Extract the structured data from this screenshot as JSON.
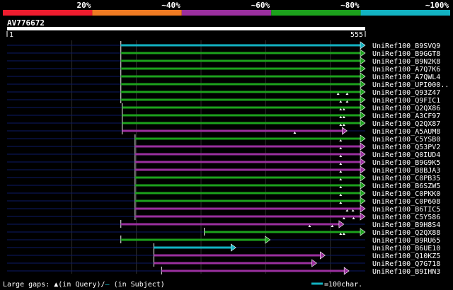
{
  "identity_scale": {
    "segments": [
      {
        "label": "20%",
        "color": "#ee1c2e"
      },
      {
        "label": "~40%",
        "color": "#ee7a22"
      },
      {
        "label": "~60%",
        "color": "#9a2f9e"
      },
      {
        "label": "~80%",
        "color": "#1ca11c"
      },
      {
        "label": "~100%",
        "color": "#12b2c2"
      }
    ]
  },
  "query": {
    "id": "AV776672",
    "start_label": "1",
    "end_label": "555",
    "length": 555
  },
  "hits": [
    {
      "name": "UniRef100_B9SVQ9",
      "start": 177,
      "end": 555,
      "color": "#12b2c2",
      "gaps": []
    },
    {
      "name": "UniRef100_B9GGT8",
      "start": 177,
      "end": 555,
      "color": "#1ca11c",
      "gaps": []
    },
    {
      "name": "UniRef100_B9N2K8",
      "start": 177,
      "end": 555,
      "color": "#1ca11c",
      "gaps": []
    },
    {
      "name": "UniRef100_A7Q7K6",
      "start": 177,
      "end": 555,
      "color": "#1ca11c",
      "gaps": []
    },
    {
      "name": "UniRef100_A7QWL4",
      "start": 177,
      "end": 555,
      "color": "#1ca11c",
      "gaps": []
    },
    {
      "name": "UniRef100_UPI000..",
      "start": 177,
      "end": 555,
      "color": "#1ca11c",
      "gaps": []
    },
    {
      "name": "UniRef100_Q93Z47",
      "start": 177,
      "end": 555,
      "color": "#1ca11c",
      "gaps": [
        513,
        527
      ]
    },
    {
      "name": "UniRef100_Q9FIC1",
      "start": 177,
      "end": 555,
      "color": "#1ca11c",
      "gaps": [
        517,
        527
      ]
    },
    {
      "name": "UniRef100_Q2QX86",
      "start": 179,
      "end": 555,
      "color": "#1ca11c",
      "gaps": [
        517,
        522
      ]
    },
    {
      "name": "UniRef100_A3CF97",
      "start": 179,
      "end": 555,
      "color": "#1ca11c",
      "gaps": [
        517,
        522
      ]
    },
    {
      "name": "UniRef100_Q2QX87",
      "start": 179,
      "end": 555,
      "color": "#1ca11c",
      "gaps": [
        517,
        522
      ]
    },
    {
      "name": "UniRef100_A5AUM8",
      "start": 179,
      "end": 527,
      "color": "#9a2f9e",
      "gaps": [
        446
      ]
    },
    {
      "name": "UniRef100_C5YSB0",
      "start": 199,
      "end": 555,
      "color": "#1ca11c",
      "gaps": [
        517
      ]
    },
    {
      "name": "UniRef100_Q53PV2",
      "start": 199,
      "end": 555,
      "color": "#9a2f9e",
      "gaps": [
        517
      ]
    },
    {
      "name": "UniRef100_Q0IUD4",
      "start": 199,
      "end": 555,
      "color": "#9a2f9e",
      "gaps": [
        517
      ]
    },
    {
      "name": "UniRef100_B9G9K5",
      "start": 199,
      "end": 555,
      "color": "#9a2f9e",
      "gaps": [
        517
      ]
    },
    {
      "name": "UniRef100_B8BJA3",
      "start": 199,
      "end": 555,
      "color": "#9a2f9e",
      "gaps": [
        517
      ]
    },
    {
      "name": "UniRef100_C0PB35",
      "start": 199,
      "end": 555,
      "color": "#1ca11c",
      "gaps": [
        517
      ]
    },
    {
      "name": "UniRef100_B6SZW5",
      "start": 199,
      "end": 555,
      "color": "#1ca11c",
      "gaps": [
        517
      ]
    },
    {
      "name": "UniRef100_C0PKK0",
      "start": 199,
      "end": 555,
      "color": "#1ca11c",
      "gaps": [
        517
      ]
    },
    {
      "name": "UniRef100_C0P608",
      "start": 199,
      "end": 555,
      "color": "#1ca11c",
      "gaps": [
        517
      ]
    },
    {
      "name": "UniRef100_B6TIC5",
      "start": 199,
      "end": 555,
      "color": "#9a2f9e",
      "gaps": [
        527,
        536
      ]
    },
    {
      "name": "UniRef100_C5Y586",
      "start": 199,
      "end": 555,
      "color": "#9a2f9e",
      "gaps": [
        522,
        537
      ]
    },
    {
      "name": "UniRef100_B9H8S4",
      "start": 177,
      "end": 522,
      "color": "#9a2f9e",
      "gaps": [
        469,
        504
      ]
    },
    {
      "name": "UniRef100_Q2QX88",
      "start": 306,
      "end": 555,
      "color": "#1ca11c",
      "gaps": [
        517,
        522
      ]
    },
    {
      "name": "UniRef100_B9RU65",
      "start": 177,
      "end": 408,
      "color": "#1ca11c",
      "gaps": []
    },
    {
      "name": "UniRef100_B6UE10",
      "start": 228,
      "end": 355,
      "color": "#12b2c2",
      "gaps": []
    },
    {
      "name": "UniRef100_Q10KZ5",
      "start": 228,
      "end": 493,
      "color": "#9a2f9e",
      "gaps": []
    },
    {
      "name": "UniRef100_Q7G718",
      "start": 228,
      "end": 480,
      "color": "#9a2f9e",
      "gaps": []
    },
    {
      "name": "UniRef100_B9IHN3",
      "start": 240,
      "end": 530,
      "color": "#9a2f9e",
      "gaps": []
    }
  ],
  "legend": {
    "gaps_text_prefix": "Large gaps: ",
    "gaps_text_query": "(in Query)/",
    "gaps_text_subject": " (in Subject)",
    "scale_label": "=100char."
  }
}
